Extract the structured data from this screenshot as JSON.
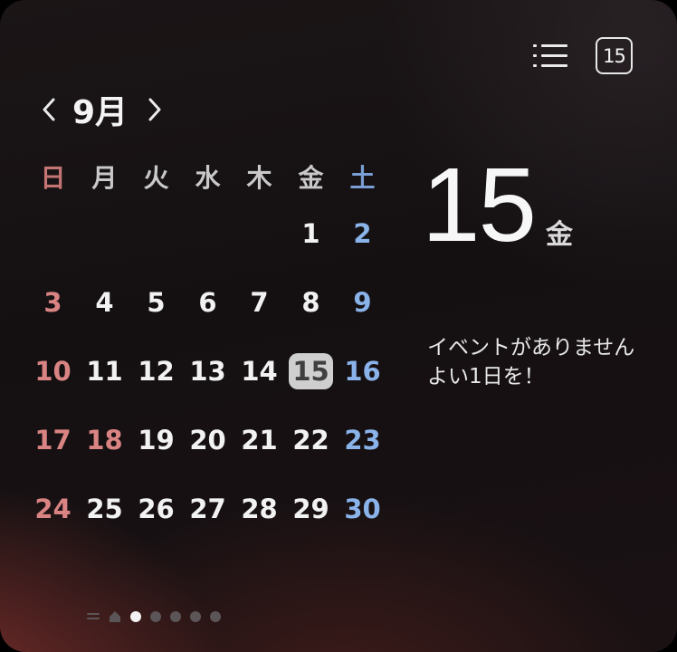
{
  "header": {
    "icons": [
      "list-icon",
      "calendar-today-icon"
    ],
    "calendar_icon_day": "15"
  },
  "month_nav": {
    "prev_icon": "chevron-left-icon",
    "month_label": "9月",
    "next_icon": "chevron-right-icon"
  },
  "calendar": {
    "weekdays": [
      "日",
      "月",
      "火",
      "水",
      "木",
      "金",
      "土"
    ],
    "weeks": [
      [
        "",
        "",
        "",
        "",
        "",
        "1",
        "2"
      ],
      [
        "3",
        "4",
        "5",
        "6",
        "7",
        "8",
        "9"
      ],
      [
        "10",
        "11",
        "12",
        "13",
        "14",
        "15",
        "16"
      ],
      [
        "17",
        "18",
        "19",
        "20",
        "21",
        "22",
        "23"
      ],
      [
        "24",
        "25",
        "26",
        "27",
        "28",
        "29",
        "30"
      ]
    ],
    "holiday_days": [
      "18"
    ],
    "selected_day": "15"
  },
  "selected": {
    "day": "15",
    "weekday": "金"
  },
  "events": {
    "line1": "イベントがありません",
    "line2": "よい1日を！"
  },
  "pager": {
    "items": [
      "list-icon",
      "home-icon",
      "dot",
      "dot",
      "dot",
      "dot",
      "dot"
    ],
    "active_index": 2
  },
  "colors": {
    "sunday": "#d98483",
    "saturday": "#8ab3ea",
    "text": "#f2f2f2",
    "today_bg": "#cfcfcf"
  }
}
